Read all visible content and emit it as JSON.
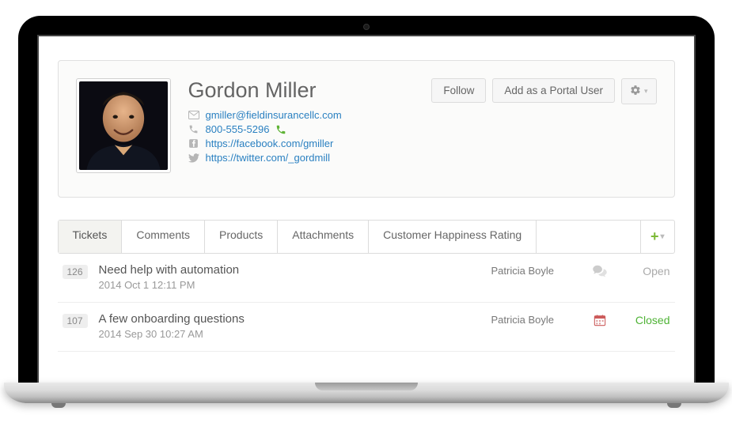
{
  "profile": {
    "name": "Gordon Miller",
    "email": "gmiller@fieldinsurancellc.com",
    "phone": "800-555-5296",
    "facebook": "https://facebook.com/gmiller",
    "twitter": "https://twitter.com/_gordmill"
  },
  "actions": {
    "follow": "Follow",
    "add_portal": "Add as a Portal User"
  },
  "tabs": [
    {
      "label": "Tickets",
      "active": true
    },
    {
      "label": "Comments",
      "active": false
    },
    {
      "label": "Products",
      "active": false
    },
    {
      "label": "Attachments",
      "active": false
    },
    {
      "label": "Customer Happiness Rating",
      "active": false
    }
  ],
  "tickets": [
    {
      "id": "126",
      "title": "Need help with automation",
      "date": "2014 Oct 1 12:11 PM",
      "assignee": "Patricia Boyle",
      "type_icon": "chat-icon",
      "status_label": "Open",
      "status_class": "status-open"
    },
    {
      "id": "107",
      "title": "A few onboarding questions",
      "date": "2014 Sep 30 10:27 AM",
      "assignee": "Patricia Boyle",
      "type_icon": "calendar-icon",
      "status_label": "Closed",
      "status_class": "status-closed"
    }
  ]
}
